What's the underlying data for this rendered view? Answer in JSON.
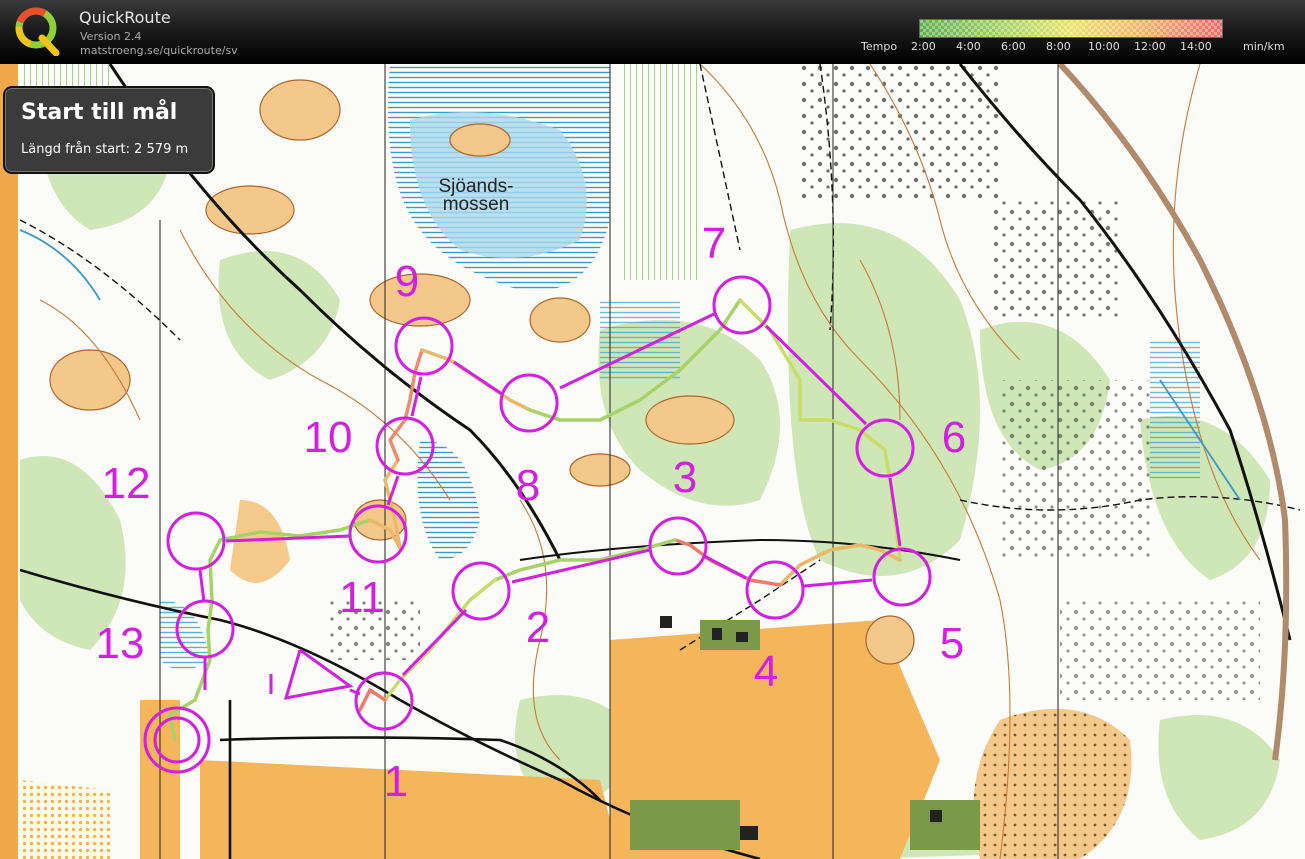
{
  "app": {
    "title": "QuickRoute",
    "version": "Version 2.4",
    "url": "matstroeng.se/quickroute/sv"
  },
  "pace_legend": {
    "label": "Tempo",
    "ticks": [
      "2:00",
      "4:00",
      "6:00",
      "8:00",
      "10:00",
      "12:00",
      "14:00"
    ],
    "unit": "min/km",
    "colors": [
      "#5fb04f",
      "#a7d26a",
      "#e9e46a",
      "#f3b06a",
      "#ef6b6b"
    ]
  },
  "info": {
    "title": "Start till mål",
    "length": "Längd från start: 2 579 m"
  },
  "map": {
    "place_name_line1": "Sjöands-",
    "place_name_line2": "mossen",
    "course_color": "#d21fe0",
    "controls": [
      {
        "number": "1"
      },
      {
        "number": "2"
      },
      {
        "number": "3"
      },
      {
        "number": "4"
      },
      {
        "number": "5"
      },
      {
        "number": "6"
      },
      {
        "number": "7"
      },
      {
        "number": "8"
      },
      {
        "number": "9"
      },
      {
        "number": "10"
      },
      {
        "number": "11"
      },
      {
        "number": "12"
      },
      {
        "number": "13"
      }
    ]
  }
}
